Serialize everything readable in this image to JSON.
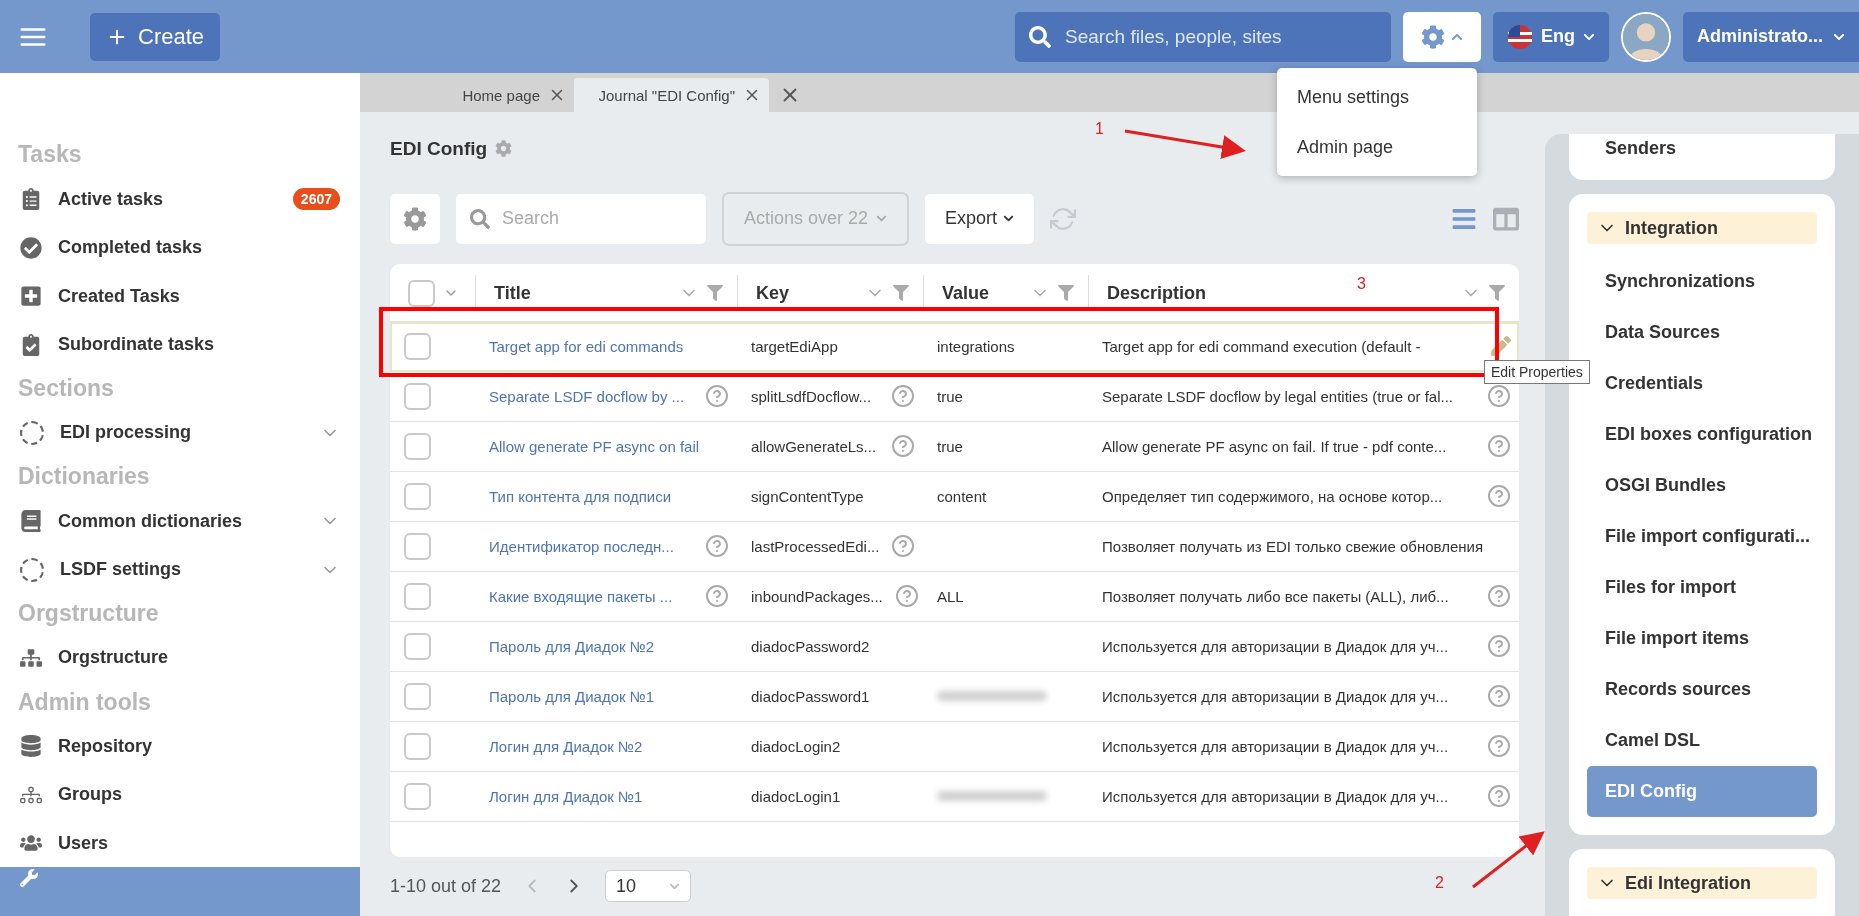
{
  "header": {
    "create_label": "Create",
    "search_placeholder": "Search files, people, sites",
    "language": "Eng",
    "user": "Administrato..."
  },
  "settings_menu": {
    "open": true,
    "items": [
      "Menu settings",
      "Admin page"
    ]
  },
  "tabs": [
    {
      "label": "Home page",
      "selected": false
    },
    {
      "label": "Journal \"EDI Config\"",
      "selected": true
    }
  ],
  "sidebar": {
    "sections": [
      {
        "title": "Tasks",
        "items": [
          {
            "label": "Active tasks",
            "badge": "2607",
            "expandable": false,
            "selected": false
          },
          {
            "label": "Completed tasks",
            "expandable": false,
            "selected": false
          },
          {
            "label": "Created Tasks",
            "expandable": false,
            "selected": false
          },
          {
            "label": "Subordinate tasks",
            "expandable": false,
            "selected": false
          }
        ]
      },
      {
        "title": "Sections",
        "items": [
          {
            "label": "EDI processing",
            "expandable": true,
            "selected": false
          }
        ]
      },
      {
        "title": "Dictionaries",
        "items": [
          {
            "label": "Common dictionaries",
            "expandable": true,
            "selected": false
          },
          {
            "label": "LSDF settings",
            "expandable": true,
            "selected": false
          }
        ]
      },
      {
        "title": "Orgstructure",
        "items": [
          {
            "label": "Orgstructure",
            "expandable": false,
            "selected": false
          }
        ]
      },
      {
        "title": "Admin tools",
        "items": [
          {
            "label": "Repository",
            "expandable": false,
            "selected": false
          },
          {
            "label": "Groups",
            "expandable": false,
            "selected": false
          },
          {
            "label": "Users",
            "expandable": false,
            "selected": false
          },
          {
            "expandable": false,
            "selected": true
          }
        ]
      }
    ]
  },
  "journal": {
    "title": "EDI Config",
    "search_placeholder": "Search",
    "actions": {
      "label": "Actions over 22",
      "disabled": true
    },
    "export": "Export",
    "all_checked": false,
    "columns": [
      "Title",
      "Key",
      "Value",
      "Description"
    ],
    "rows": [
      {
        "checked": false,
        "title": "Target app for edi commands",
        "title_help": false,
        "key": "targetEdiApp",
        "key_help": false,
        "value": "integrations",
        "redacted": false,
        "description": "Target app for edi command execution (default -",
        "description_help": false,
        "editable": true,
        "highlighted": true
      },
      {
        "checked": false,
        "title": "Separate LSDF docflow by ...",
        "title_help": true,
        "key": "splitLsdfDocflow...",
        "key_help": true,
        "value": "true",
        "redacted": false,
        "description": "Separate LSDF docflow by legal entities (true or fal...",
        "description_help": true,
        "editable": false,
        "highlighted": false
      },
      {
        "checked": false,
        "title": "Allow generate PF async on fail",
        "title_help": false,
        "key": "allowGenerateLs...",
        "key_help": true,
        "value": "true",
        "redacted": false,
        "description": "Allow generate PF async on fail. If true - pdf conte...",
        "description_help": true,
        "editable": false,
        "highlighted": false
      },
      {
        "checked": false,
        "title": "Тип контента для подписи",
        "title_help": false,
        "key": "signContentType",
        "key_help": false,
        "value": "content",
        "redacted": false,
        "description": "Определяет тип содержимого, на основе котор...",
        "description_help": true,
        "editable": false,
        "highlighted": false
      },
      {
        "checked": false,
        "title": "Идентификатор последн...",
        "title_help": true,
        "key": "lastProcessedEdi...",
        "key_help": true,
        "redacted": false,
        "description": "Позволяет получать из EDI только свежие обновления",
        "description_help": false,
        "editable": false,
        "highlighted": false
      },
      {
        "checked": false,
        "title": "Какие входящие пакеты ...",
        "title_help": true,
        "key": "inboundPackages...",
        "key_help": true,
        "value": "ALL",
        "redacted": false,
        "description": "Позволяет получать либо все пакеты (ALL), либ...",
        "description_help": true,
        "editable": false,
        "highlighted": false
      },
      {
        "checked": false,
        "title": "Пароль для Диадок №2",
        "title_help": false,
        "key": "diadocPassword2",
        "key_help": false,
        "redacted": false,
        "description": "Используется для авторизации в Диадок для уч...",
        "description_help": true,
        "editable": false,
        "highlighted": false
      },
      {
        "checked": false,
        "title": "Пароль для Диадок №1",
        "title_help": false,
        "key": "diadocPassword1",
        "key_help": false,
        "redacted": true,
        "description": "Используется для авторизации в Диадок для уч...",
        "description_help": true,
        "editable": false,
        "highlighted": false
      },
      {
        "checked": false,
        "title": "Логин для Диадок №2",
        "title_help": false,
        "key": "diadocLogin2",
        "key_help": false,
        "redacted": false,
        "description": "Используется для авторизации в Диадок для уч...",
        "description_help": true,
        "editable": false,
        "highlighted": false
      },
      {
        "checked": false,
        "title": "Логин для Диадок №1",
        "title_help": false,
        "key": "diadocLogin1",
        "key_help": false,
        "redacted": true,
        "description": "Используется для авторизации в Диадок для уч...",
        "description_help": true,
        "editable": false,
        "highlighted": false
      }
    ],
    "tooltip": "Edit Properties",
    "pagination": {
      "range": "1-10 out of 22",
      "page_size": "10"
    }
  },
  "right_panel": {
    "cards": [
      {
        "items": [
          {
            "label": "Senders",
            "selected": false
          }
        ]
      },
      {
        "header": "Integration",
        "items": [
          {
            "label": "Synchronizations",
            "selected": false
          },
          {
            "label": "Data Sources",
            "selected": false
          },
          {
            "label": "Credentials",
            "selected": false
          },
          {
            "label": "EDI boxes configuration",
            "selected": false
          },
          {
            "label": "OSGI Bundles",
            "selected": false
          },
          {
            "label": "File import configurati...",
            "selected": false
          },
          {
            "label": "Files for import",
            "selected": false
          },
          {
            "label": "File import items",
            "selected": false
          },
          {
            "label": "Records sources",
            "selected": false
          },
          {
            "label": "Camel DSL",
            "selected": false
          },
          {
            "label": "EDI Config",
            "selected": true
          }
        ]
      },
      {
        "header": "Edi Integration"
      }
    ]
  },
  "annotations": [
    "1",
    "3",
    "2"
  ]
}
